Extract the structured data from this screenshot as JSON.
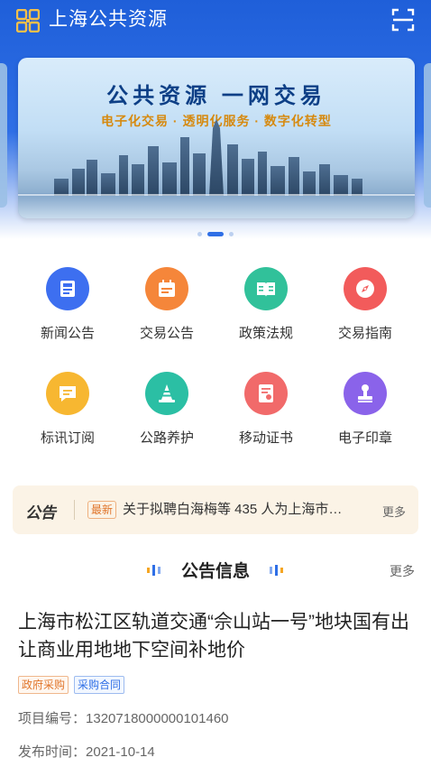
{
  "header": {
    "title": "上海公共资源"
  },
  "banner": {
    "title": "公共资源 一网交易",
    "subtitle": "电子化交易 · 透明化服务 · 数字化转型",
    "slide_count": 3,
    "active_slide": 2
  },
  "grid": [
    {
      "label": "新闻公告",
      "icon": "newspaper-icon",
      "color": "#3d6ff0"
    },
    {
      "label": "交易公告",
      "icon": "calendar-icon",
      "color": "#f5863a"
    },
    {
      "label": "政策法规",
      "icon": "book-icon",
      "color": "#31c19a"
    },
    {
      "label": "交易指南",
      "icon": "compass-icon",
      "color": "#f25b5b"
    },
    {
      "label": "标讯订阅",
      "icon": "message-icon",
      "color": "#f7b731"
    },
    {
      "label": "公路养护",
      "icon": "traffic-cone-icon",
      "color": "#2bbfa4"
    },
    {
      "label": "移动证书",
      "icon": "certificate-icon",
      "color": "#f16a6a"
    },
    {
      "label": "电子印章",
      "icon": "stamp-icon",
      "color": "#8a63ea"
    }
  ],
  "notice": {
    "tag": "公告",
    "badge": "最新",
    "text": "关于拟聘白海梅等 435 人为上海市…",
    "more": "更多"
  },
  "section": {
    "title": "公告信息",
    "more": "更多"
  },
  "article": {
    "title": "上海市松江区轨道交通“佘山站一号”地块国有出让商业用地地下空间补地价",
    "tags": [
      "政府采购",
      "采购合同"
    ],
    "project_no_label": "项目编号：",
    "project_no": "1320718000000101460",
    "publish_label": "发布时间：",
    "publish_date": "2021-10-14"
  }
}
